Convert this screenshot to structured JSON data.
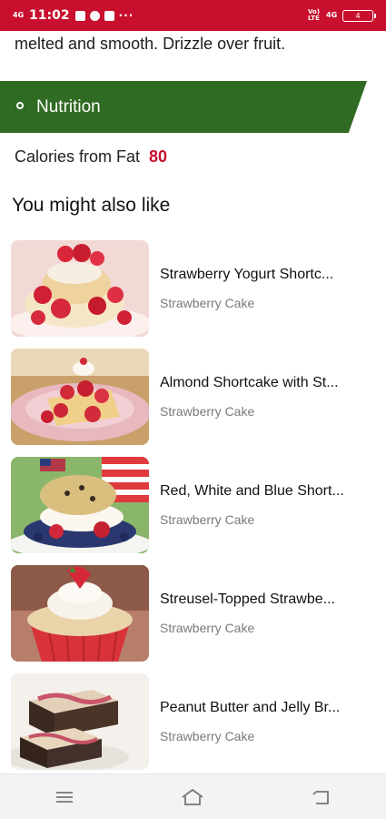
{
  "status_bar": {
    "network_left": "4G",
    "time": "11:02",
    "extra_icons": "···",
    "volte_label": "Vo) LTE",
    "network_right": "4G",
    "battery": "4"
  },
  "intro_text": "melted and smooth. Drizzle over fruit.",
  "nutrition": {
    "label": "Nutrition"
  },
  "calories": {
    "label": "Calories from Fat",
    "value": "80"
  },
  "related": {
    "title": "You might also like",
    "items": [
      {
        "title": "Strawberry Yogurt Shortc...",
        "category": "Strawberry Cake",
        "icon": "strawberry-yogurt-shortcake-image"
      },
      {
        "title": "Almond Shortcake with St...",
        "category": "Strawberry Cake",
        "icon": "almond-shortcake-image"
      },
      {
        "title": "Red, White and Blue Short...",
        "category": "Strawberry Cake",
        "icon": "red-white-blue-shortcake-image"
      },
      {
        "title": "Streusel-Topped Strawbe...",
        "category": "Strawberry Cake",
        "icon": "streusel-cupcake-image"
      },
      {
        "title": "Peanut Butter and Jelly Br...",
        "category": "Strawberry Cake",
        "icon": "peanut-butter-jelly-brownie-image"
      }
    ]
  },
  "colors": {
    "status_bar": "#c8102e",
    "nutrition_banner": "#2f6b22",
    "calorie_value": "#c8102e"
  },
  "bottom_nav": {
    "icons": [
      "menu-icon",
      "home-icon",
      "back-icon"
    ]
  }
}
